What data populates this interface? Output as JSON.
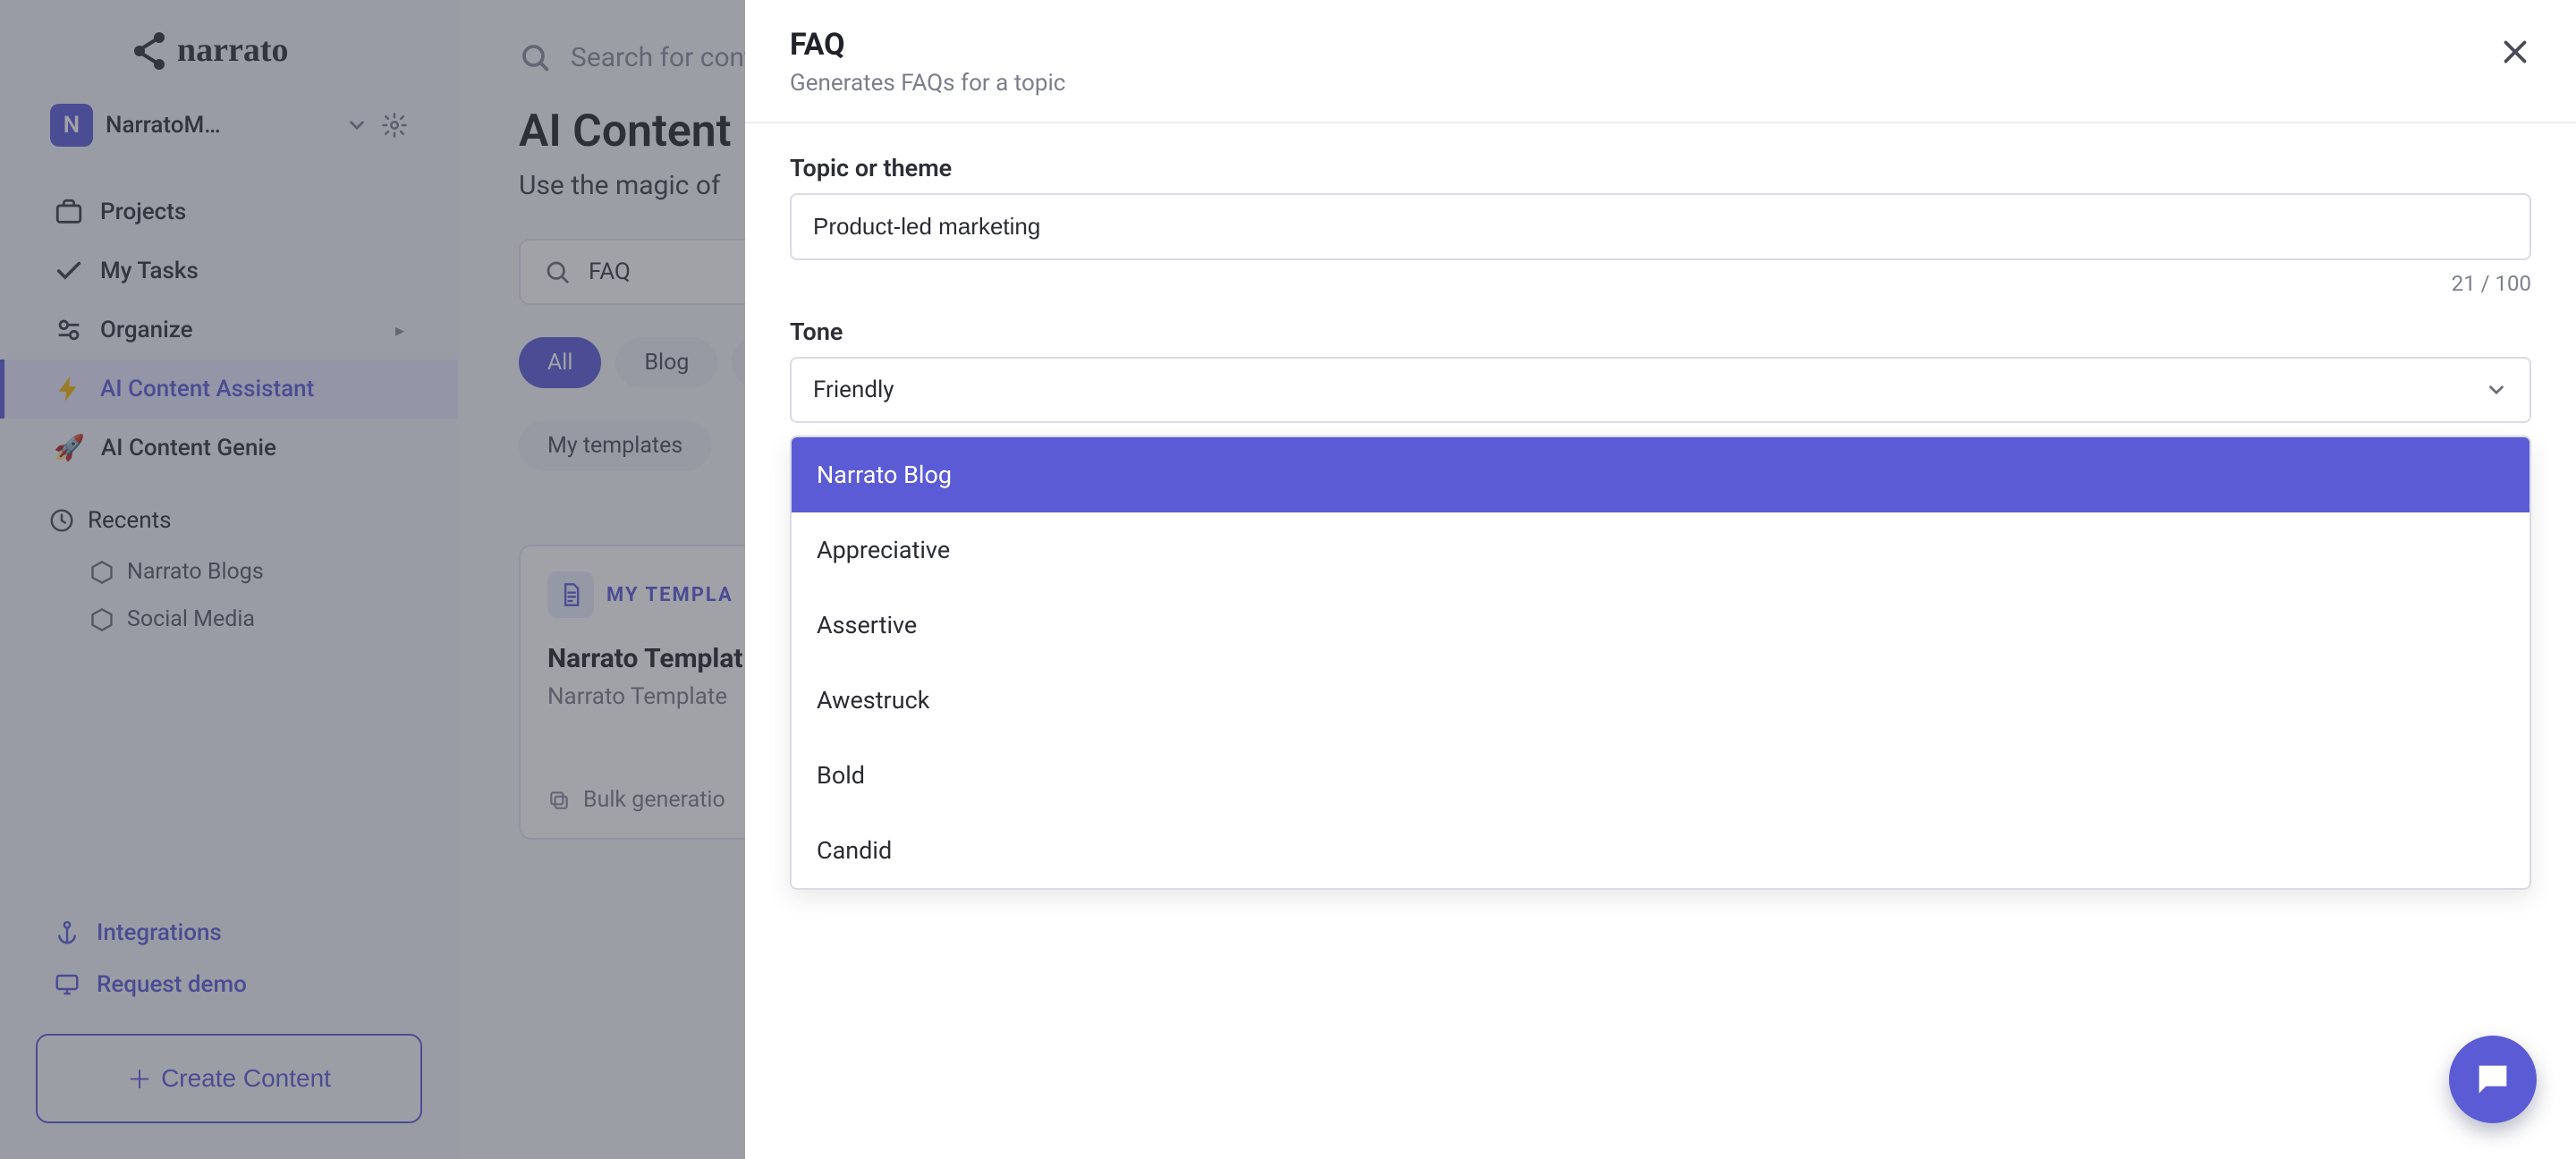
{
  "workspace": {
    "initial": "N",
    "name": "NarratoM…"
  },
  "sidebar": {
    "nav": [
      {
        "label": "Projects"
      },
      {
        "label": "My Tasks"
      },
      {
        "label": "Organize"
      },
      {
        "label": "AI Content Assistant"
      },
      {
        "label": "AI Content Genie"
      }
    ],
    "recents_header": "Recents",
    "recents": [
      {
        "label": "Narrato Blogs"
      },
      {
        "label": "Social Media"
      }
    ],
    "integrations": "Integrations",
    "request_demo": "Request demo",
    "create": "Create Content"
  },
  "top_search_placeholder": "Search for content",
  "page": {
    "title": "AI Content",
    "subtitle": "Use the magic of"
  },
  "tool_search_value": "FAQ",
  "filters": {
    "row1": [
      "All",
      "Blog",
      "S"
    ],
    "row2": [
      "My templates"
    ]
  },
  "card": {
    "tag": "MY TEMPLA",
    "title": "Narrato Templat",
    "sub": "Narrato Template",
    "footer": "Bulk generatio"
  },
  "modal": {
    "title": "FAQ",
    "subtitle": "Generates FAQs for a topic",
    "topic_label": "Topic or theme",
    "topic_value": "Product-led marketing",
    "counter": "21 / 100",
    "tone_label": "Tone",
    "tone_selected": "Friendly",
    "options": [
      "Narrato Blog",
      "Appreciative",
      "Assertive",
      "Awestruck",
      "Bold",
      "Candid"
    ]
  }
}
